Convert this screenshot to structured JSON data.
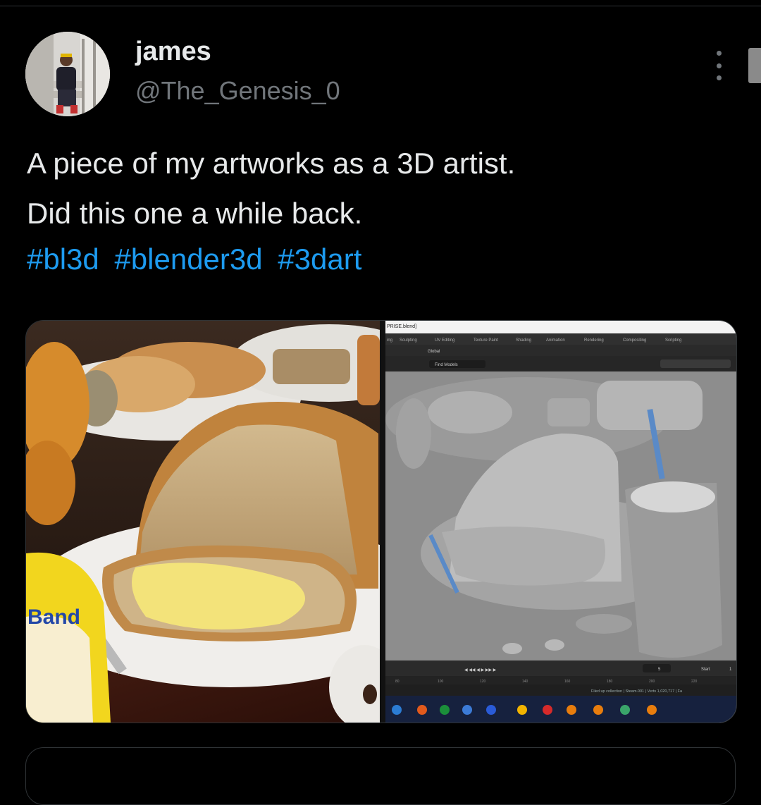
{
  "tweet": {
    "author_name": "james",
    "author_handle": "@The_Genesis_0",
    "text_line1": "A piece of my artworks as a 3D artist.",
    "text_line2": "Did this one a while back.",
    "hashtags": [
      "#bl3d",
      "#blender3d",
      "#3dart"
    ]
  },
  "media": {
    "left_image": {
      "description_visible_text": "Band"
    },
    "right_image": {
      "file_title": "PRISE.blend]",
      "workspace_tabs": [
        "ing",
        "Sculpting",
        "UV Editing",
        "Texture Paint",
        "Shading",
        "Animation",
        "Rendering",
        "Compositing",
        "Scripting"
      ],
      "orientation": "Global",
      "search_placeholder": "Find Models",
      "frame_current": "5",
      "start_label": "Start",
      "start_value": "1",
      "timeline_ticks": [
        "80",
        "100",
        "120",
        "140",
        "160",
        "180",
        "200",
        "220"
      ],
      "status_bar": "Filed up collection | Steam.001 | Verts 1,020,717 | Fa"
    }
  },
  "colors": {
    "background": "#000000",
    "text": "#e7e9ea",
    "secondary": "#71767b",
    "link": "#1d9bf0"
  },
  "icons": [
    "more-icon",
    "blender-icon",
    "windows-taskbar-icons"
  ]
}
